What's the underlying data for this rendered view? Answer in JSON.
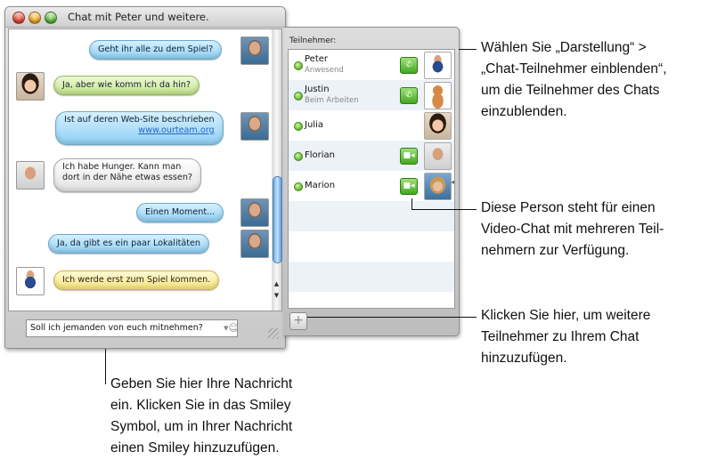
{
  "window": {
    "title": "Chat mit Peter und weitere."
  },
  "messages": [
    {
      "text": "Geht ihr alle zu dem Spiel?",
      "style": "blue"
    },
    {
      "text": "Ja, aber wie komm ich da hin?",
      "style": "green"
    },
    {
      "text": "Ist auf deren Web-Site beschrieben",
      "link": "www.ourteam.org",
      "style": "blue"
    },
    {
      "text": "Ich habe Hunger. Kann man",
      "text2": "dort in der Nähe etwas essen?",
      "style": "gray"
    },
    {
      "text": "Einen Moment...",
      "style": "blue"
    },
    {
      "text": "Ja, da gibt es ein paar Lokalitäten",
      "style": "blue"
    },
    {
      "text": "Ich werde erst zum Spiel kommen.",
      "style": "yellow"
    }
  ],
  "input": {
    "value": "Soll ich jemanden von euch mitnehmen?"
  },
  "drawer": {
    "header": "Teilnehmer:",
    "participants": [
      {
        "name": "Peter",
        "status": "Anwesend",
        "capability_icon": "phone-icon"
      },
      {
        "name": "Justin",
        "status": "Beim Arbeiten",
        "capability_icon": "phone-icon"
      },
      {
        "name": "Julia",
        "status": "",
        "capability_icon": ""
      },
      {
        "name": "Florian",
        "status": "",
        "capability_icon": "video-camera-icon"
      },
      {
        "name": "Marion",
        "status": "",
        "capability_icon": "video-camera-icon"
      }
    ],
    "add_label": "+"
  },
  "callouts": {
    "view_menu": [
      "Wählen Sie „Darstellung“ >",
      "„Chat-Teilnehmer einblenden“,",
      "um die Teilnehmer des Chats",
      "einzublenden."
    ],
    "video_chat": [
      "Diese Person steht für einen",
      "Video-Chat mit mehreren Teil-",
      "nehmern zur Verfügung."
    ],
    "add_participants": [
      "Klicken Sie hier, um weitere",
      "Teilnehmer zu Ihrem Chat",
      "hinzuzufügen."
    ],
    "message_entry": [
      "Geben Sie hier Ihre Nachricht",
      "ein. Klicken Sie in das Smiley",
      "Symbol, um in Ihrer Nachricht",
      "einen Smiley hinzuzufügen."
    ]
  },
  "colors": {
    "status_available": "#5fb42d",
    "bubble_blue": "#8fd0f4",
    "bubble_green": "#c2e38c",
    "bubble_yellow": "#f7e37a"
  }
}
